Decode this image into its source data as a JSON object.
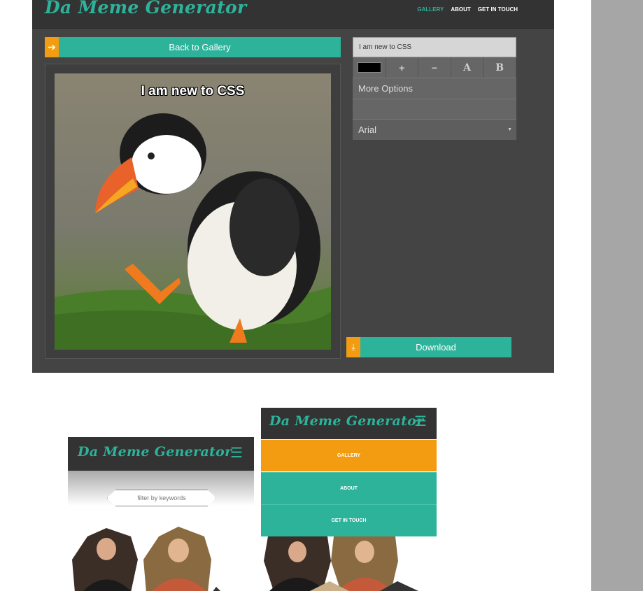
{
  "desktop": {
    "logo": "Da Meme Generator",
    "nav": [
      "GALLERY",
      "ABOUT",
      "GET IN TOUCH"
    ],
    "back_button": "Back to Gallery",
    "meme_text": "I am new to CSS",
    "text_input_value": "I am new to CSS",
    "toolbar": {
      "color": "#000000",
      "increase": "+",
      "decrease": "−",
      "font_a": "A",
      "bold": "B"
    },
    "more_options": "More Options",
    "font": {
      "selected": "Arial",
      "arrow": "▼"
    },
    "download_button": "Download"
  },
  "mobile_gallery": {
    "logo": "Da Meme Generator",
    "menu_icon": "☰",
    "filter_placeholder": "filter by keywords"
  },
  "mobile_menu": {
    "logo": "Da Meme Generator",
    "menu_icon": "☰",
    "items": [
      "GALLERY",
      "ABOUT",
      "GET IN TOUCH"
    ]
  },
  "colors": {
    "accent": "#2db39a",
    "orange": "#f39c12",
    "dark": "#333333",
    "panel": "#444444"
  },
  "icons": {
    "back": "arrow-left-icon",
    "download": "download-icon",
    "menu": "hamburger-icon"
  }
}
